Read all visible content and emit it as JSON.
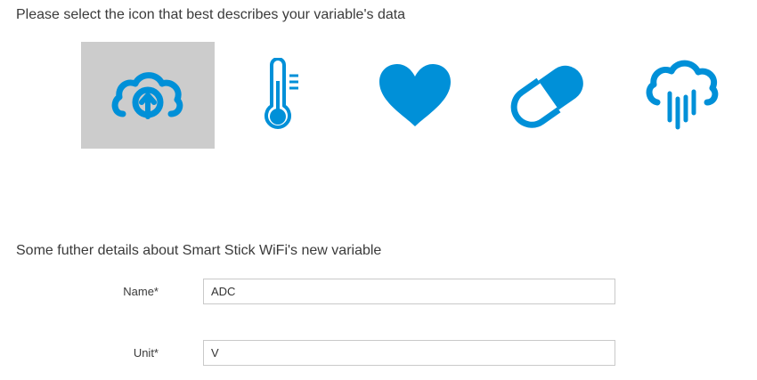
{
  "icon_section": {
    "heading": "Please select the icon that best describes your variable's data",
    "accent_color": "#0090d8",
    "selected_background": "#cccccc",
    "icons": [
      {
        "name": "cloud-upload-icon",
        "selected": true
      },
      {
        "name": "thermometer-icon",
        "selected": false
      },
      {
        "name": "heart-icon",
        "selected": false
      },
      {
        "name": "pill-icon",
        "selected": false
      },
      {
        "name": "rain-cloud-icon",
        "selected": false
      }
    ]
  },
  "details_section": {
    "heading": "Some futher details about Smart Stick WiFi's new variable",
    "fields": {
      "name": {
        "label": "Name*",
        "value": "ADC"
      },
      "unit": {
        "label": "Unit*",
        "value": "V"
      }
    }
  }
}
